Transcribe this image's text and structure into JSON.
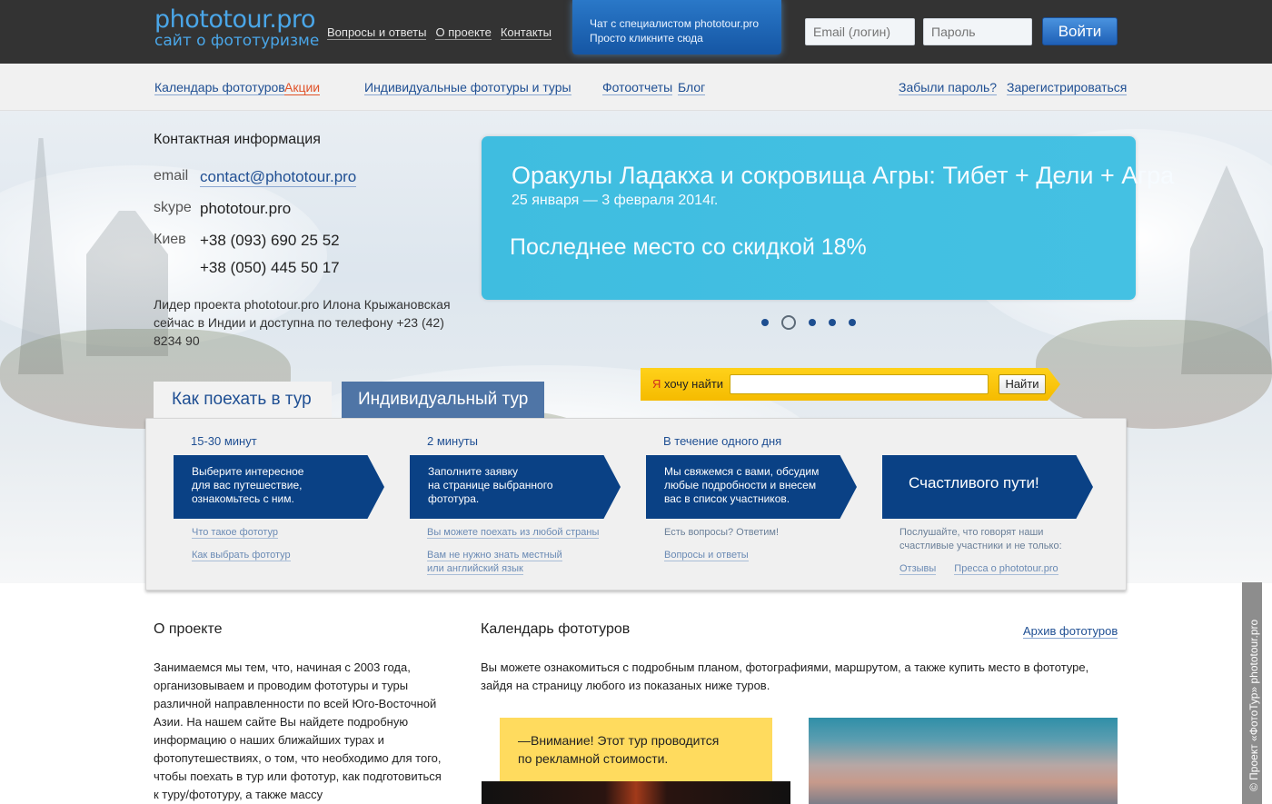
{
  "header": {
    "logo_title": "phototour.pro",
    "logo_subtitle": "сайт о фототуризме",
    "nav": [
      "Вопросы и ответы",
      "О проекте",
      "Контакты"
    ],
    "chat_line1": "Чат с специалистом phototour.pro",
    "chat_line2": "Просто кликните сюда",
    "email_placeholder": "Email (логин)",
    "password_placeholder": "Пароль",
    "login_label": "Войти"
  },
  "subnav": {
    "calendar": "Календарь фототуров",
    "promo": "Акции",
    "individual": "Индивидуальные фототуры и туры",
    "reports": "Фотоотчеты",
    "blog": "Блог",
    "forgot": "Забыли пароль?",
    "register": "Зарегистрироваться"
  },
  "contacts": {
    "title": "Контактная информация",
    "email_label": "email",
    "email_value": "contact@phototour.pro",
    "skype_label": "skype",
    "skype_value": "phototour.pro",
    "city_label": "Киев",
    "phone1": "+38 (093) 690 25 52",
    "phone2": "+38 (050) 445 50 17",
    "leader_line1": "Лидер проекта phototour.pro Илона Крыжановская",
    "leader_line2": "сейчас в Индии и доступна по телефону +23 (42) 8234 90"
  },
  "banner": {
    "title": "Оракулы Ладакха и сокровища Агры: Тибет + Дели + Агра",
    "dates": "25 января — 3 февраля 2014г.",
    "offer": "Последнее место со скидкой 18%",
    "slides_total": 5,
    "slide_active": 2,
    "accent_color": "#3fbde0"
  },
  "search": {
    "label_ya": "Я",
    "label_rest": " хочу найти",
    "button": "Найти"
  },
  "tabs": {
    "how": "Как поехать в тур",
    "individual": "Индивидуальный тур"
  },
  "steps": [
    {
      "time": "15-30 минут",
      "text_lines": [
        "Выберите интересное",
        "для вас путешествие,",
        "ознакомьтесь с ним."
      ],
      "link1": "Что такое фототур",
      "link2": "Как выбрать фототур"
    },
    {
      "time": "2 минуты",
      "text_lines": [
        "Заполните заявку",
        "на странице выбранного",
        "фототура."
      ],
      "link1": "Вы можете поехать из любой страны",
      "link2a": "Вам не нужно знать местный",
      "link2b": "или английский язык"
    },
    {
      "time": "В течение одного дня",
      "text_lines": [
        "Мы свяжемся с вами, обсудим",
        "любые подробности и внесем",
        "вас в список участников."
      ],
      "note": "Есть вопросы? Ответим!",
      "link1": "Вопросы и ответы"
    },
    {
      "text": "Счастливого пути!",
      "note_line1": "Послушайте, что говорят наши",
      "note_line2": "счастливые участники и не только:",
      "link1": "Отзывы",
      "link2": "Пресса о phototour.pro"
    }
  ],
  "about": {
    "title": "О проекте",
    "text": "Занимаемся мы тем, что, начиная с 2003 года, организовываем и проводим фототуры и туры различной направленности по всей Юго-Восточной Азии. На нашем сайте Вы найдете подробную информацию о наших ближайших турах и фотопутешествиях,  о том, что необходимо для того, чтобы поехать в тур или фототур, как подготовиться к туру/фототуру, а также массу"
  },
  "calendar": {
    "title": "Календарь фототуров",
    "archive": "Архив фототуров",
    "text": "Вы можете ознакомиться с подробным планом, фотографиями, маршрутом, а также купить место в фототуре, зайдя на страницу любого из показаных ниже туров.",
    "notice_line1": "—Внимание! Этот тур проводится",
    "notice_line2": "по рекламной стоимости."
  },
  "stamp": "© Проект «ФотоТур» phototour.pro"
}
